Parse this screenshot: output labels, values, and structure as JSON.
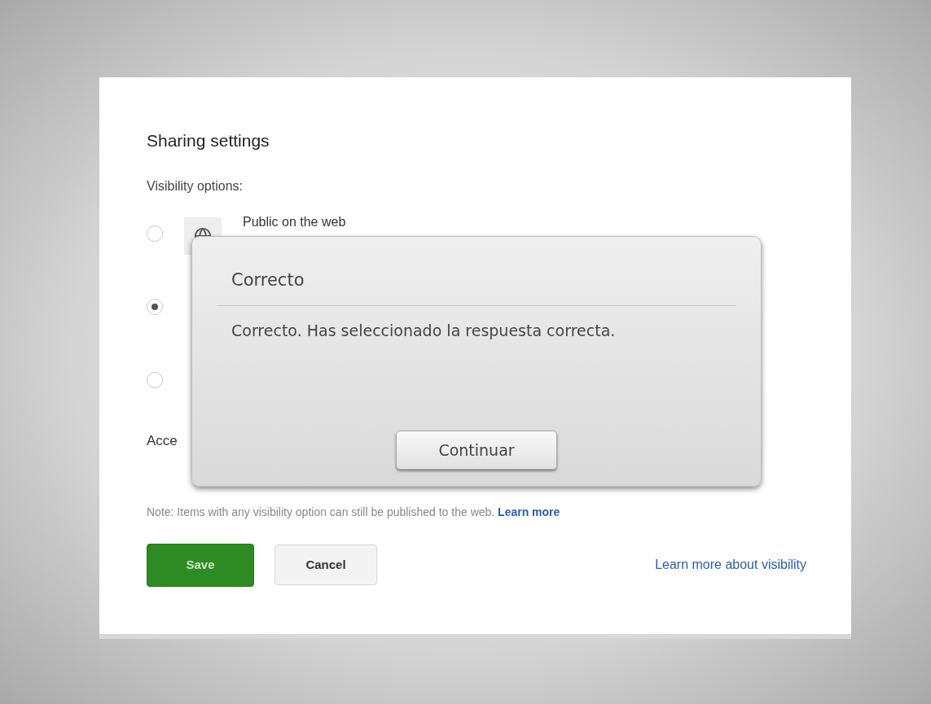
{
  "panel": {
    "title": "Sharing settings",
    "visibility_label": "Visibility options:",
    "options": [
      {
        "label": "Public on the web",
        "selected": false
      },
      {
        "selected": true
      },
      {
        "selected": false
      }
    ],
    "access_label": "Acce",
    "note": "Note: Items with any visibility option can still be published to the web.",
    "note_link": "Learn more",
    "buttons": [
      {
        "label": "Save",
        "kind": "primary"
      },
      {
        "label": "Cancel",
        "kind": "secondary"
      }
    ],
    "visibility_link": "Learn more about visibility"
  },
  "dialog": {
    "title": "Correcto",
    "message": "Correcto. Has seleccionado la respuesta correcta.",
    "button": "Continuar"
  }
}
